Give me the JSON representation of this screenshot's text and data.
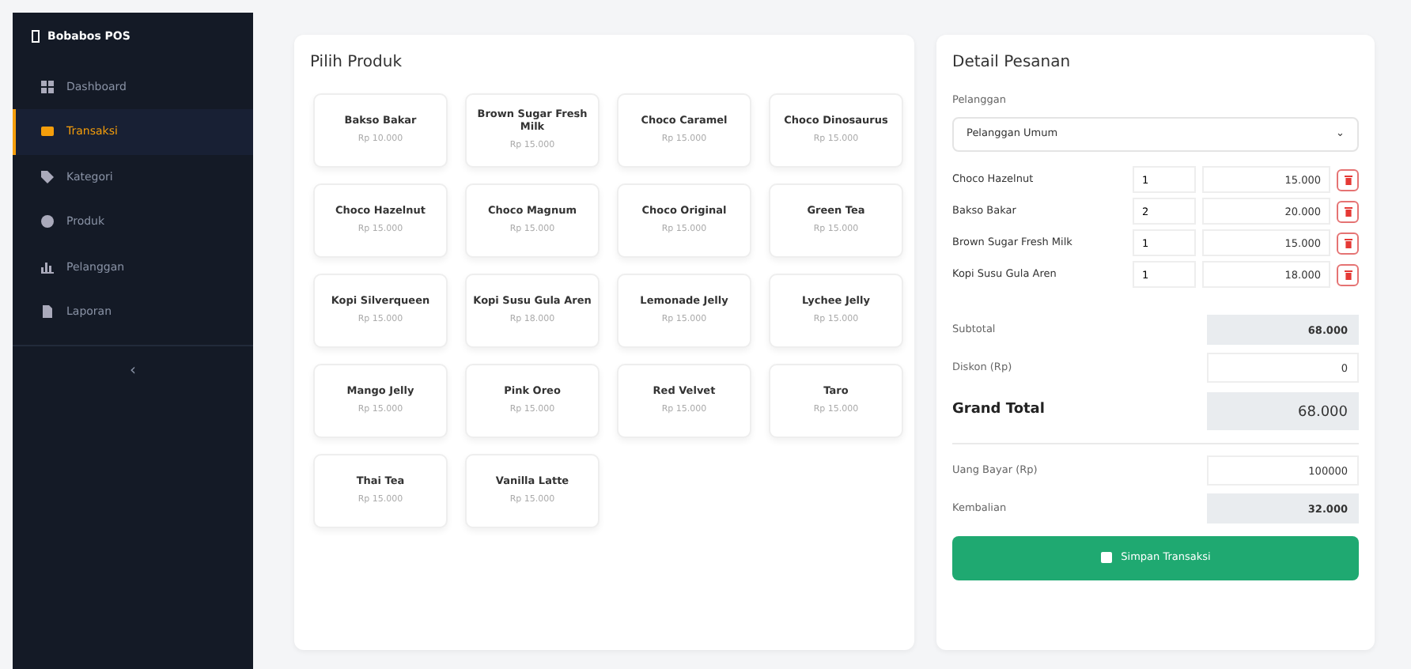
{
  "sidebar": {
    "brand": "Bobabos POS",
    "items": [
      {
        "label": "Dashboard",
        "selected": false
      },
      {
        "label": "Transaksi",
        "selected": true
      },
      {
        "label": "Kategori",
        "selected": false
      },
      {
        "label": "Produk",
        "selected": false
      },
      {
        "label": "Pelanggan",
        "selected": false
      },
      {
        "label": "Laporan",
        "selected": false
      }
    ],
    "collapse": "‹"
  },
  "products": {
    "title": "Pilih Produk",
    "items": [
      {
        "name": "Bakso Bakar",
        "price": "Rp 10.000"
      },
      {
        "name": "Brown Sugar Fresh Milk",
        "price": "Rp 15.000"
      },
      {
        "name": "Choco Caramel",
        "price": "Rp 15.000"
      },
      {
        "name": "Choco Dinosaurus",
        "price": "Rp 15.000"
      },
      {
        "name": "Choco Hazelnut",
        "price": "Rp 15.000"
      },
      {
        "name": "Choco Magnum",
        "price": "Rp 15.000"
      },
      {
        "name": "Choco Original",
        "price": "Rp 15.000"
      },
      {
        "name": "Green Tea",
        "price": "Rp 15.000"
      },
      {
        "name": "Kopi Silverqueen",
        "price": "Rp 15.000"
      },
      {
        "name": "Kopi Susu Gula Aren",
        "price": "Rp 18.000"
      },
      {
        "name": "Lemonade Jelly",
        "price": "Rp 15.000"
      },
      {
        "name": "Lychee Jelly",
        "price": "Rp 15.000"
      },
      {
        "name": "Mango Jelly",
        "price": "Rp 15.000"
      },
      {
        "name": "Pink Oreo",
        "price": "Rp 15.000"
      },
      {
        "name": "Red Velvet",
        "price": "Rp 15.000"
      },
      {
        "name": "Taro",
        "price": "Rp 15.000"
      },
      {
        "name": "Thai Tea",
        "price": "Rp 15.000"
      },
      {
        "name": "Vanilla Latte",
        "price": "Rp 15.000"
      }
    ]
  },
  "order": {
    "title": "Detail Pesanan",
    "customer_label": "Pelanggan",
    "customer": "Pelanggan Umum",
    "customer_caret": "⌄",
    "items": [
      {
        "name": "Choco Hazelnut",
        "qty": "1",
        "total": "15.000"
      },
      {
        "name": "Bakso Bakar",
        "qty": "2",
        "total": "20.000"
      },
      {
        "name": "Brown Sugar Fresh Milk",
        "qty": "1",
        "total": "15.000"
      },
      {
        "name": "Kopi Susu Gula Aren",
        "qty": "1",
        "total": "18.000"
      }
    ],
    "subtotal_label": "Subtotal",
    "subtotal": "68.000",
    "discount_label": "Diskon (Rp)",
    "discount": "0",
    "grand_total_label": "Grand Total",
    "grand_total": "68.000",
    "paid_label": "Uang Bayar (Rp)",
    "paid": "100000",
    "change_label": "Kembalian",
    "change": "32.000",
    "save_button": "Simpan Transaksi"
  }
}
